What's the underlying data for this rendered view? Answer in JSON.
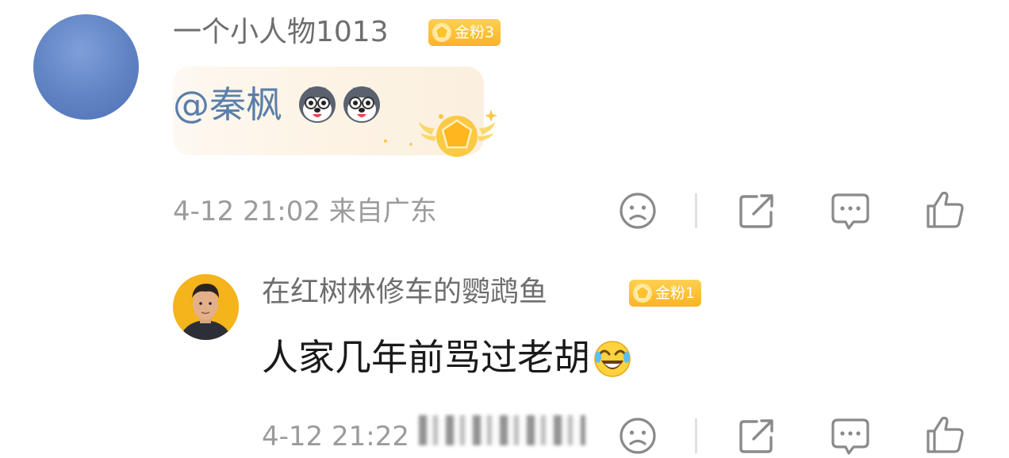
{
  "comment": {
    "username": "一个小人物1013",
    "badge": "金粉3",
    "mention": "@秦枫",
    "meta": "4-12 21:02 来自广东"
  },
  "reply": {
    "username": "在红树林修车的鹦鹉鱼",
    "badge": "金粉1",
    "text": "人家几年前骂过老胡",
    "meta": "4-12 21:22"
  },
  "icons": {
    "dislike": "frown-face-icon",
    "share": "share-icon",
    "comment": "comment-icon",
    "like": "thumbs-up-icon"
  },
  "colors": {
    "badge": "#f9b425",
    "mention": "#5b7ea9",
    "meta": "#9b9b9b",
    "username": "#6e6e6e",
    "bubble": "#fdf5e9"
  }
}
